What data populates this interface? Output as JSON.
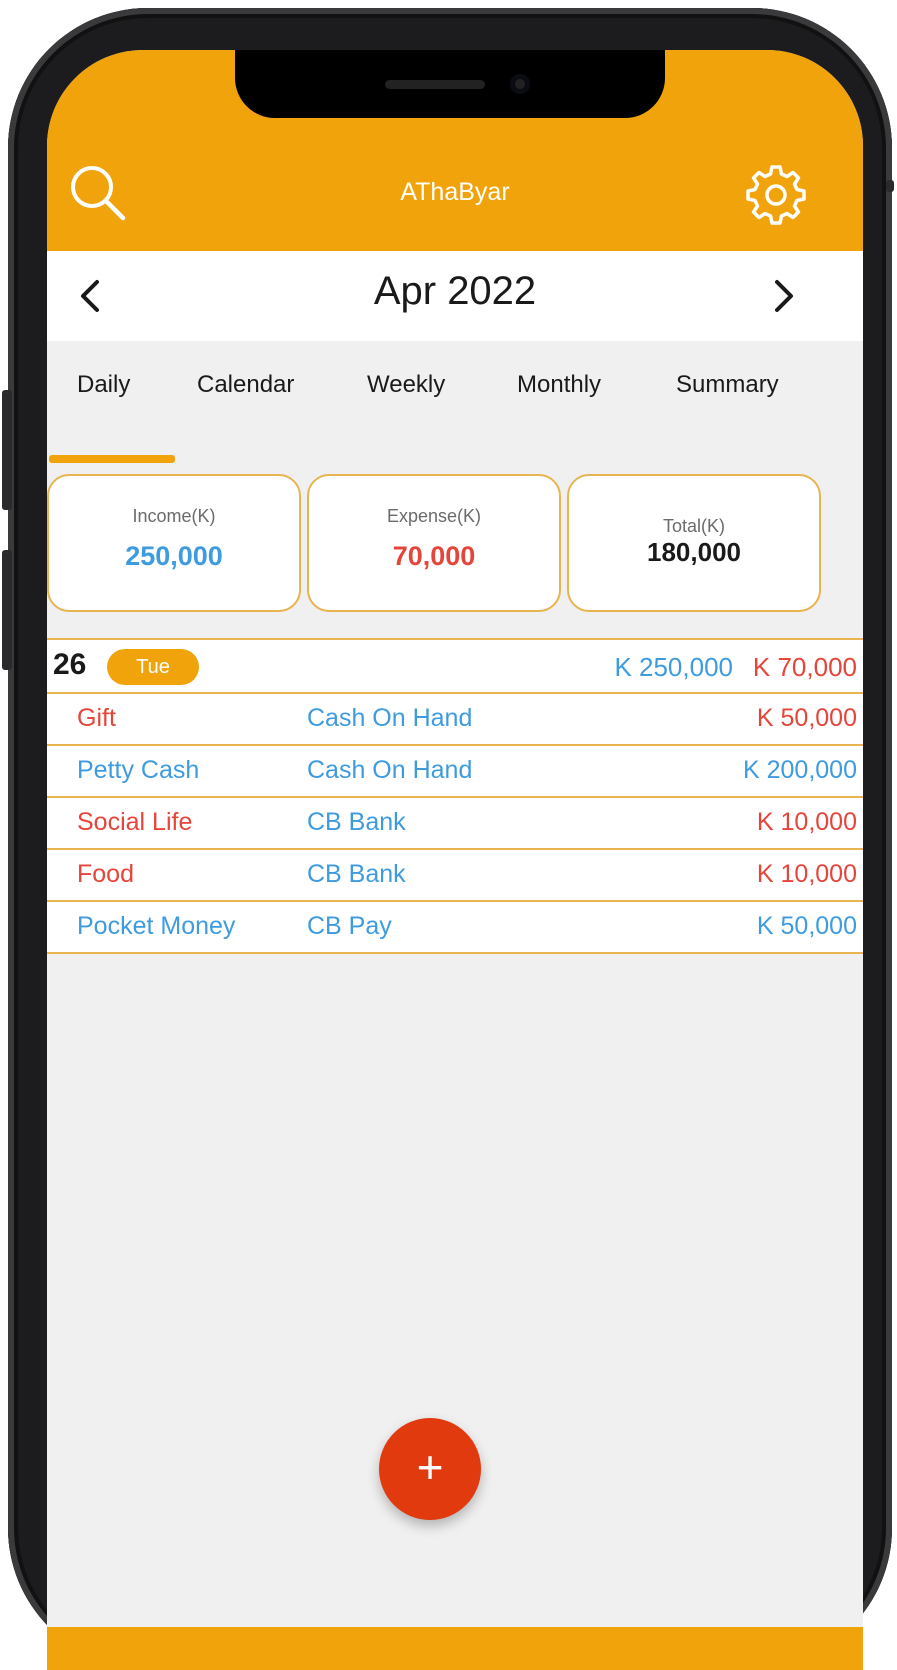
{
  "app": {
    "title": "AThaByar"
  },
  "header": {
    "search_icon": "search-icon",
    "settings_icon": "gear-icon"
  },
  "month_nav": {
    "label": "Apr 2022",
    "prev_icon": "chevron-left-icon",
    "next_icon": "chevron-right-icon"
  },
  "tabs": [
    {
      "label": "Daily",
      "active": true
    },
    {
      "label": "Calendar",
      "active": false
    },
    {
      "label": "Weekly",
      "active": false
    },
    {
      "label": "Monthly",
      "active": false
    },
    {
      "label": "Summary",
      "active": false
    }
  ],
  "summary": {
    "income": {
      "label": "Income(K)",
      "value": "250,000"
    },
    "expense": {
      "label": "Expense(K)",
      "value": "70,000"
    },
    "total": {
      "label": "Total(K)",
      "value": "180,000"
    }
  },
  "day": {
    "number": "26",
    "weekday": "Tue",
    "income": "K 250,000",
    "expense": "K 70,000"
  },
  "transactions": [
    {
      "category": "Gift",
      "account": "Cash On Hand",
      "amount": "K 50,000",
      "type": "expense"
    },
    {
      "category": "Petty Cash",
      "account": "Cash On Hand",
      "amount": "K 200,000",
      "type": "income"
    },
    {
      "category": "Social Life",
      "account": "CB Bank",
      "amount": "K 10,000",
      "type": "expense"
    },
    {
      "category": "Food",
      "account": "CB Bank",
      "amount": "K 10,000",
      "type": "expense"
    },
    {
      "category": "Pocket Money",
      "account": "CB Pay",
      "amount": "K 50,000",
      "type": "income"
    }
  ],
  "fab": {
    "label": "+",
    "icon": "plus-icon"
  },
  "colors": {
    "accent": "#f0a30a",
    "income": "#3e9be0",
    "expense": "#e5453a",
    "fab": "#e03a0e"
  }
}
